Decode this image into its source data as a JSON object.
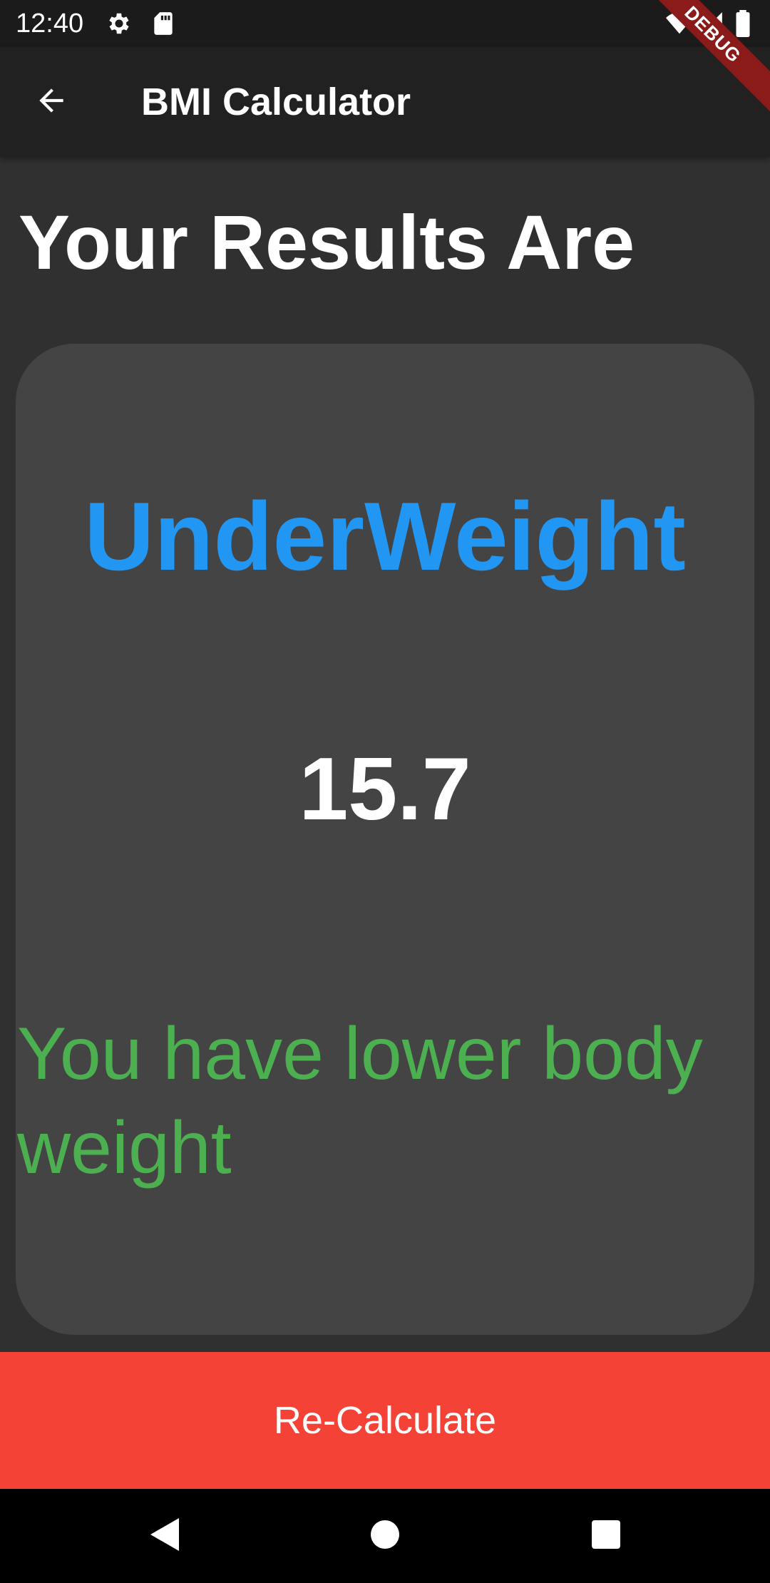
{
  "status_bar": {
    "time": "12:40",
    "icons": [
      "gear-icon",
      "sd-card-icon",
      "wifi-icon",
      "signal-icon",
      "battery-icon"
    ]
  },
  "app_bar": {
    "title": "BMI Calculator",
    "back_icon": "arrow-back-icon"
  },
  "debug_banner": {
    "label": "DEBUG"
  },
  "results": {
    "heading": "Your Results Are",
    "category": "UnderWeight",
    "bmi_value": "15.7",
    "message": "You have lower body weight"
  },
  "actions": {
    "recalculate_label": "Re-Calculate"
  },
  "nav_bar": {
    "icons": [
      "back-triangle-icon",
      "home-circle-icon",
      "recents-square-icon"
    ]
  },
  "colors": {
    "background": "#303030",
    "card": "#444444",
    "app_bar": "#212121",
    "category": "#2196f3",
    "message": "#4caf50",
    "button": "#f44336"
  }
}
